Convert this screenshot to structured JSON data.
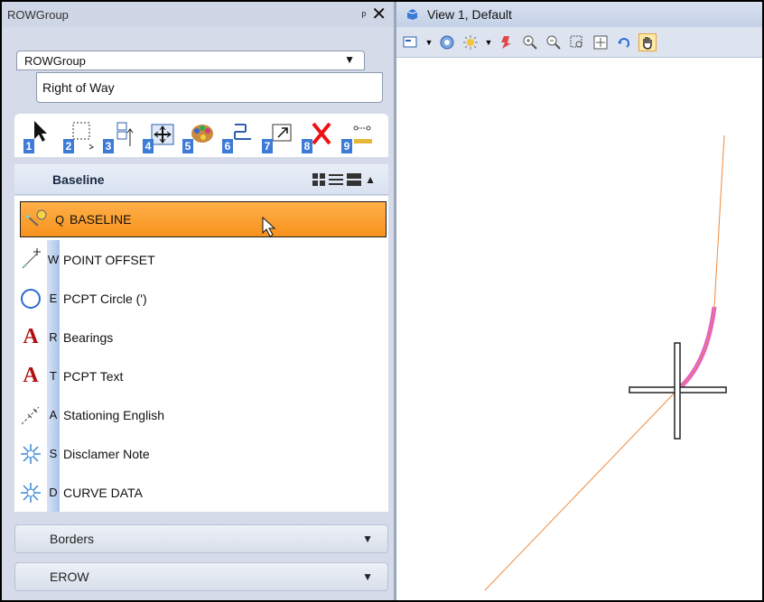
{
  "left_panel": {
    "title": "ROWGroup",
    "pin_icon": "pin-icon",
    "close_icon": "close-icon",
    "combo_value": "ROWGroup",
    "combo_popup_item": "Right of Way",
    "tools": [
      {
        "num": "1",
        "icon": "arrow-select-icon"
      },
      {
        "num": "2",
        "icon": "fence-select-icon"
      },
      {
        "num": "3",
        "icon": "place-element-icon"
      },
      {
        "num": "4",
        "icon": "move-icon"
      },
      {
        "num": "5",
        "icon": "palette-icon"
      },
      {
        "num": "6",
        "icon": "align-icon"
      },
      {
        "num": "7",
        "icon": "scale-icon"
      },
      {
        "num": "8",
        "icon": "delete-icon"
      },
      {
        "num": "9",
        "icon": "measure-icon"
      }
    ],
    "group": {
      "name": "Baseline",
      "items": [
        {
          "key": "Q",
          "label": "BASELINE",
          "icon": "baseline-icon",
          "selected": true
        },
        {
          "key": "W",
          "label": "POINT OFFSET",
          "icon": "point-offset-icon"
        },
        {
          "key": "E",
          "label": "PCPT Circle (')",
          "icon": "circle-icon"
        },
        {
          "key": "R",
          "label": "Bearings",
          "icon": "text-a-icon"
        },
        {
          "key": "T",
          "label": "PCPT Text",
          "icon": "text-a-icon"
        },
        {
          "key": "A",
          "label": "Stationing English",
          "icon": "stationing-icon"
        },
        {
          "key": "S",
          "label": "Disclamer Note",
          "icon": "note-icon"
        },
        {
          "key": "D",
          "label": "CURVE DATA",
          "icon": "note-icon"
        }
      ]
    },
    "collapsed_groups": [
      "Borders",
      "EROW"
    ]
  },
  "view": {
    "title": "View 1, Default"
  },
  "colors": {
    "selected_row": "#f7921c",
    "line": "#f08a3a",
    "curve_highlight": "#e060d0",
    "key_column": "#a9c3ea"
  }
}
